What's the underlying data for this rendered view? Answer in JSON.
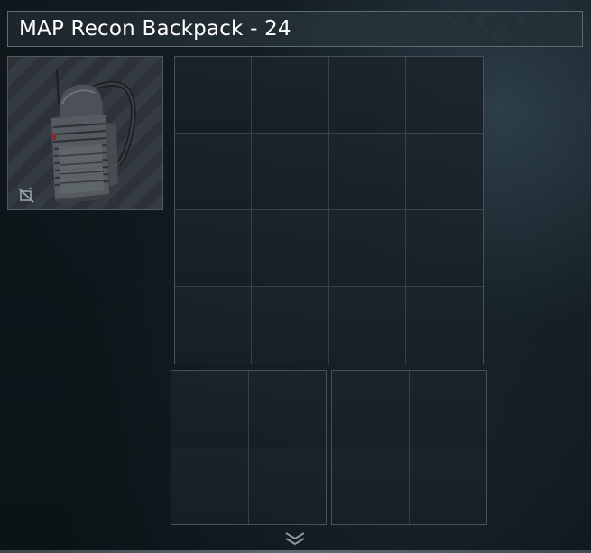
{
  "header": {
    "title": "MAP Recon Backpack - 24"
  },
  "item": {
    "icon": "backpack-icon",
    "badge_icon": "no-discard-icon"
  },
  "containers": {
    "main_grid": {
      "columns": 4,
      "rows": 4
    },
    "pocket_left": {
      "columns": 2,
      "rows": 2
    },
    "pocket_right": {
      "columns": 2,
      "rows": 2
    }
  },
  "footer": {
    "expand_icon": "double-chevron-down-icon"
  },
  "colors": {
    "background": "#0d1418",
    "border": "#5d6c73",
    "title_text": "#ffffff"
  }
}
